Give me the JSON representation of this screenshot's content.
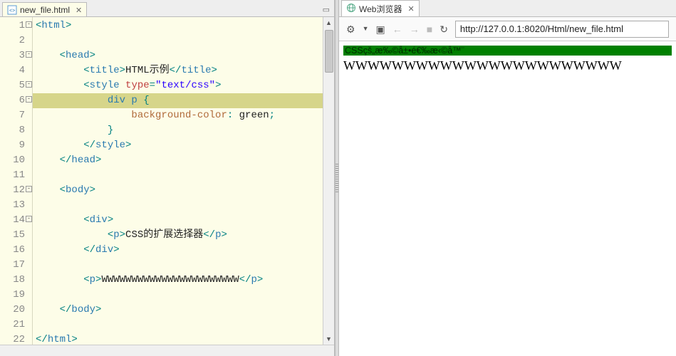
{
  "editor": {
    "tab": {
      "filename": "new_file.html"
    },
    "lines": [
      {
        "n": 1,
        "fold": true,
        "hl": false,
        "segments": [
          [
            "punct",
            "<"
          ],
          [
            "tag",
            "html"
          ],
          [
            "punct",
            ">"
          ]
        ]
      },
      {
        "n": 2,
        "fold": false,
        "hl": false,
        "segments": []
      },
      {
        "n": 3,
        "fold": true,
        "hl": false,
        "segments": [
          [
            "txt",
            "    "
          ],
          [
            "punct",
            "<"
          ],
          [
            "tag",
            "head"
          ],
          [
            "punct",
            ">"
          ]
        ]
      },
      {
        "n": 4,
        "fold": false,
        "hl": false,
        "segments": [
          [
            "txt",
            "        "
          ],
          [
            "punct",
            "<"
          ],
          [
            "tag",
            "title"
          ],
          [
            "punct",
            ">"
          ],
          [
            "txt",
            "HTML示例"
          ],
          [
            "punct",
            "</"
          ],
          [
            "tag",
            "title"
          ],
          [
            "punct",
            ">"
          ]
        ]
      },
      {
        "n": 5,
        "fold": true,
        "hl": false,
        "segments": [
          [
            "txt",
            "        "
          ],
          [
            "punct",
            "<"
          ],
          [
            "tag",
            "style"
          ],
          [
            "txt",
            " "
          ],
          [
            "attr",
            "type"
          ],
          [
            "punct",
            "="
          ],
          [
            "str",
            "\"text/css\""
          ],
          [
            "punct",
            ">"
          ]
        ]
      },
      {
        "n": 6,
        "fold": true,
        "hl": true,
        "segments": [
          [
            "txt",
            "            "
          ],
          [
            "kw",
            "div p"
          ],
          [
            "txt",
            " "
          ],
          [
            "punct",
            "{"
          ]
        ]
      },
      {
        "n": 7,
        "fold": false,
        "hl": false,
        "segments": [
          [
            "txt",
            "                "
          ],
          [
            "prop",
            "background-color"
          ],
          [
            "punct",
            ":"
          ],
          [
            "txt",
            " green"
          ],
          [
            "punct",
            ";"
          ]
        ]
      },
      {
        "n": 8,
        "fold": false,
        "hl": false,
        "segments": [
          [
            "txt",
            "            "
          ],
          [
            "punct",
            "}"
          ]
        ]
      },
      {
        "n": 9,
        "fold": false,
        "hl": false,
        "segments": [
          [
            "txt",
            "        "
          ],
          [
            "punct",
            "</"
          ],
          [
            "tag",
            "style"
          ],
          [
            "punct",
            ">"
          ]
        ]
      },
      {
        "n": 10,
        "fold": false,
        "hl": false,
        "segments": [
          [
            "txt",
            "    "
          ],
          [
            "punct",
            "</"
          ],
          [
            "tag",
            "head"
          ],
          [
            "punct",
            ">"
          ]
        ]
      },
      {
        "n": 11,
        "fold": false,
        "hl": false,
        "segments": []
      },
      {
        "n": 12,
        "fold": true,
        "hl": false,
        "segments": [
          [
            "txt",
            "    "
          ],
          [
            "punct",
            "<"
          ],
          [
            "tag",
            "body"
          ],
          [
            "punct",
            ">"
          ]
        ]
      },
      {
        "n": 13,
        "fold": false,
        "hl": false,
        "segments": []
      },
      {
        "n": 14,
        "fold": true,
        "hl": false,
        "segments": [
          [
            "txt",
            "        "
          ],
          [
            "punct",
            "<"
          ],
          [
            "tag",
            "div"
          ],
          [
            "punct",
            ">"
          ]
        ]
      },
      {
        "n": 15,
        "fold": false,
        "hl": false,
        "segments": [
          [
            "txt",
            "            "
          ],
          [
            "punct",
            "<"
          ],
          [
            "tag",
            "p"
          ],
          [
            "punct",
            ">"
          ],
          [
            "txt",
            "CSS的扩展选择器"
          ],
          [
            "punct",
            "</"
          ],
          [
            "tag",
            "p"
          ],
          [
            "punct",
            ">"
          ]
        ]
      },
      {
        "n": 16,
        "fold": false,
        "hl": false,
        "segments": [
          [
            "txt",
            "        "
          ],
          [
            "punct",
            "</"
          ],
          [
            "tag",
            "div"
          ],
          [
            "punct",
            ">"
          ]
        ]
      },
      {
        "n": 17,
        "fold": false,
        "hl": false,
        "segments": []
      },
      {
        "n": 18,
        "fold": false,
        "hl": false,
        "segments": [
          [
            "txt",
            "        "
          ],
          [
            "punct",
            "<"
          ],
          [
            "tag",
            "p"
          ],
          [
            "punct",
            ">"
          ],
          [
            "txt",
            "WWWWWWWWWWWWWWWWWWWWWWW"
          ],
          [
            "punct",
            "</"
          ],
          [
            "tag",
            "p"
          ],
          [
            "punct",
            ">"
          ]
        ]
      },
      {
        "n": 19,
        "fold": false,
        "hl": false,
        "segments": []
      },
      {
        "n": 20,
        "fold": false,
        "hl": false,
        "segments": [
          [
            "txt",
            "    "
          ],
          [
            "punct",
            "</"
          ],
          [
            "tag",
            "body"
          ],
          [
            "punct",
            ">"
          ]
        ]
      },
      {
        "n": 21,
        "fold": false,
        "hl": false,
        "segments": []
      },
      {
        "n": 22,
        "fold": false,
        "hl": false,
        "segments": [
          [
            "punct",
            "</"
          ],
          [
            "tag",
            "html"
          ],
          [
            "punct",
            ">"
          ]
        ]
      }
    ]
  },
  "browser": {
    "tab_label": "Web浏览器",
    "url": "http://127.0.0.1:8020/Html/new_file.html",
    "green_text": "CSSçš„æ‰©å±•é€‰æ‹©å™¨",
    "body_text": "WWWWWWWWWWWWWWWWWWWWWWW"
  }
}
